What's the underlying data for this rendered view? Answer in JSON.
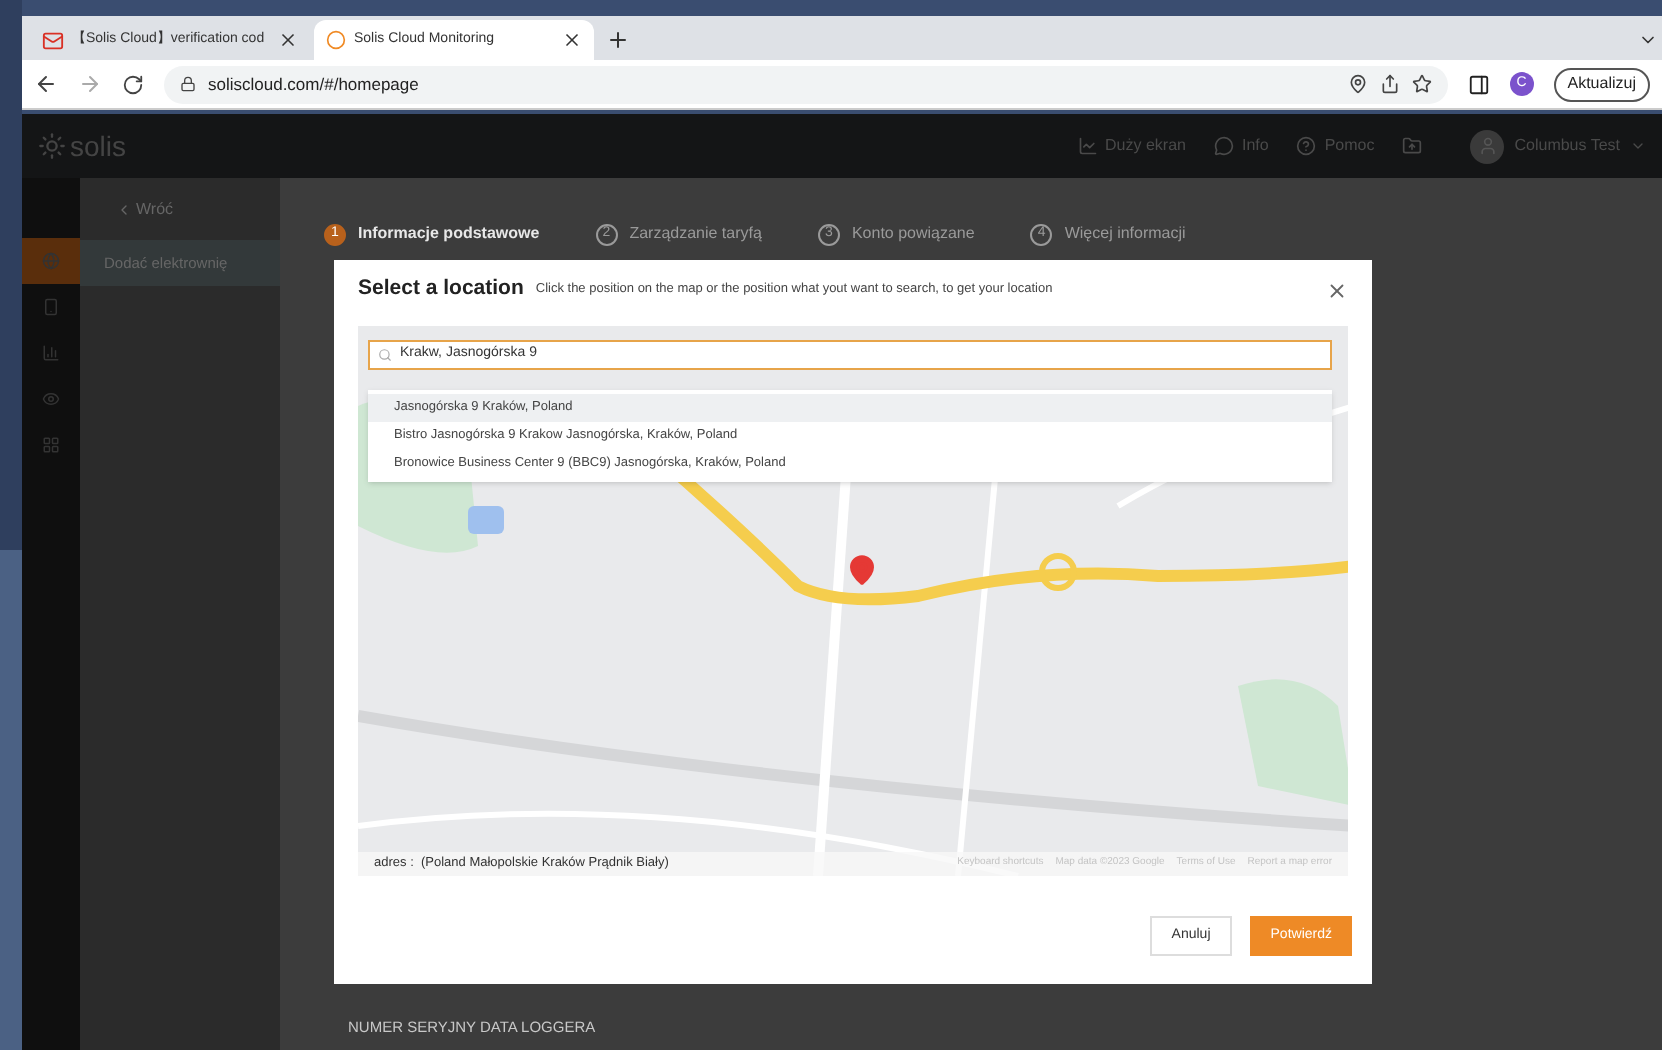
{
  "browser": {
    "tabs": [
      {
        "kind": "mail",
        "title": "【Solis Cloud】verification cod",
        "selected": false
      },
      {
        "kind": "site",
        "title": "Solis Cloud Monitoring",
        "selected": true
      }
    ],
    "url": "soliscloud.com/#/homepage",
    "profile_initial": "C",
    "update_button": "Aktualizuj"
  },
  "app_header": {
    "logo": "solis",
    "nav": [
      {
        "kind": "screen",
        "label": "Duży ekran"
      },
      {
        "kind": "chat",
        "label": "Info"
      },
      {
        "kind": "help",
        "label": "Pomoc"
      }
    ],
    "user": "Columbus Test"
  },
  "rail": [
    {
      "kind": "globe",
      "selected": true
    },
    {
      "kind": "device",
      "selected": false
    },
    {
      "kind": "chart",
      "selected": false
    },
    {
      "kind": "eye",
      "selected": false
    },
    {
      "kind": "grid",
      "selected": false
    }
  ],
  "sidebar": {
    "back": "Wróć",
    "items": [
      {
        "label": "Dodać elektrownię",
        "selected": true
      }
    ]
  },
  "steps": [
    {
      "number": "1",
      "label": "Informacje podstawowe",
      "selected": true
    },
    {
      "number": "2",
      "label": "Zarządzanie taryfą",
      "selected": false
    },
    {
      "number": "3",
      "label": "Konto powiązane",
      "selected": false
    },
    {
      "number": "4",
      "label": "Więcej informacji",
      "selected": false
    }
  ],
  "form": {
    "label": "NUMER SERYJNY DATA LOGGERA"
  },
  "modal": {
    "title": "Select a location",
    "subtitle": "Click the position on the map or the position what yout want to search, to get your location",
    "search": {
      "value": "Krakw, Jasnogórska 9"
    },
    "suggestions": [
      {
        "text": "Jasnogórska 9 Kraków, Poland",
        "selected": true
      },
      {
        "text": "Bistro Jasnogórska 9 Krakow Jasnogórska, Kraków, Poland",
        "selected": false
      },
      {
        "text": "Bronowice Business Center 9 (BBC9) Jasnogórska, Kraków, Poland",
        "selected": false
      }
    ],
    "address": "adres :  (Poland Małopolskie Kraków Prądnik Biały)",
    "attribution": [
      "Keyboard shortcuts",
      "Map data ©2023 Google",
      "Terms of Use",
      "Report a map error"
    ],
    "cancel": "Anuluj",
    "confirm": "Potwierdź"
  }
}
